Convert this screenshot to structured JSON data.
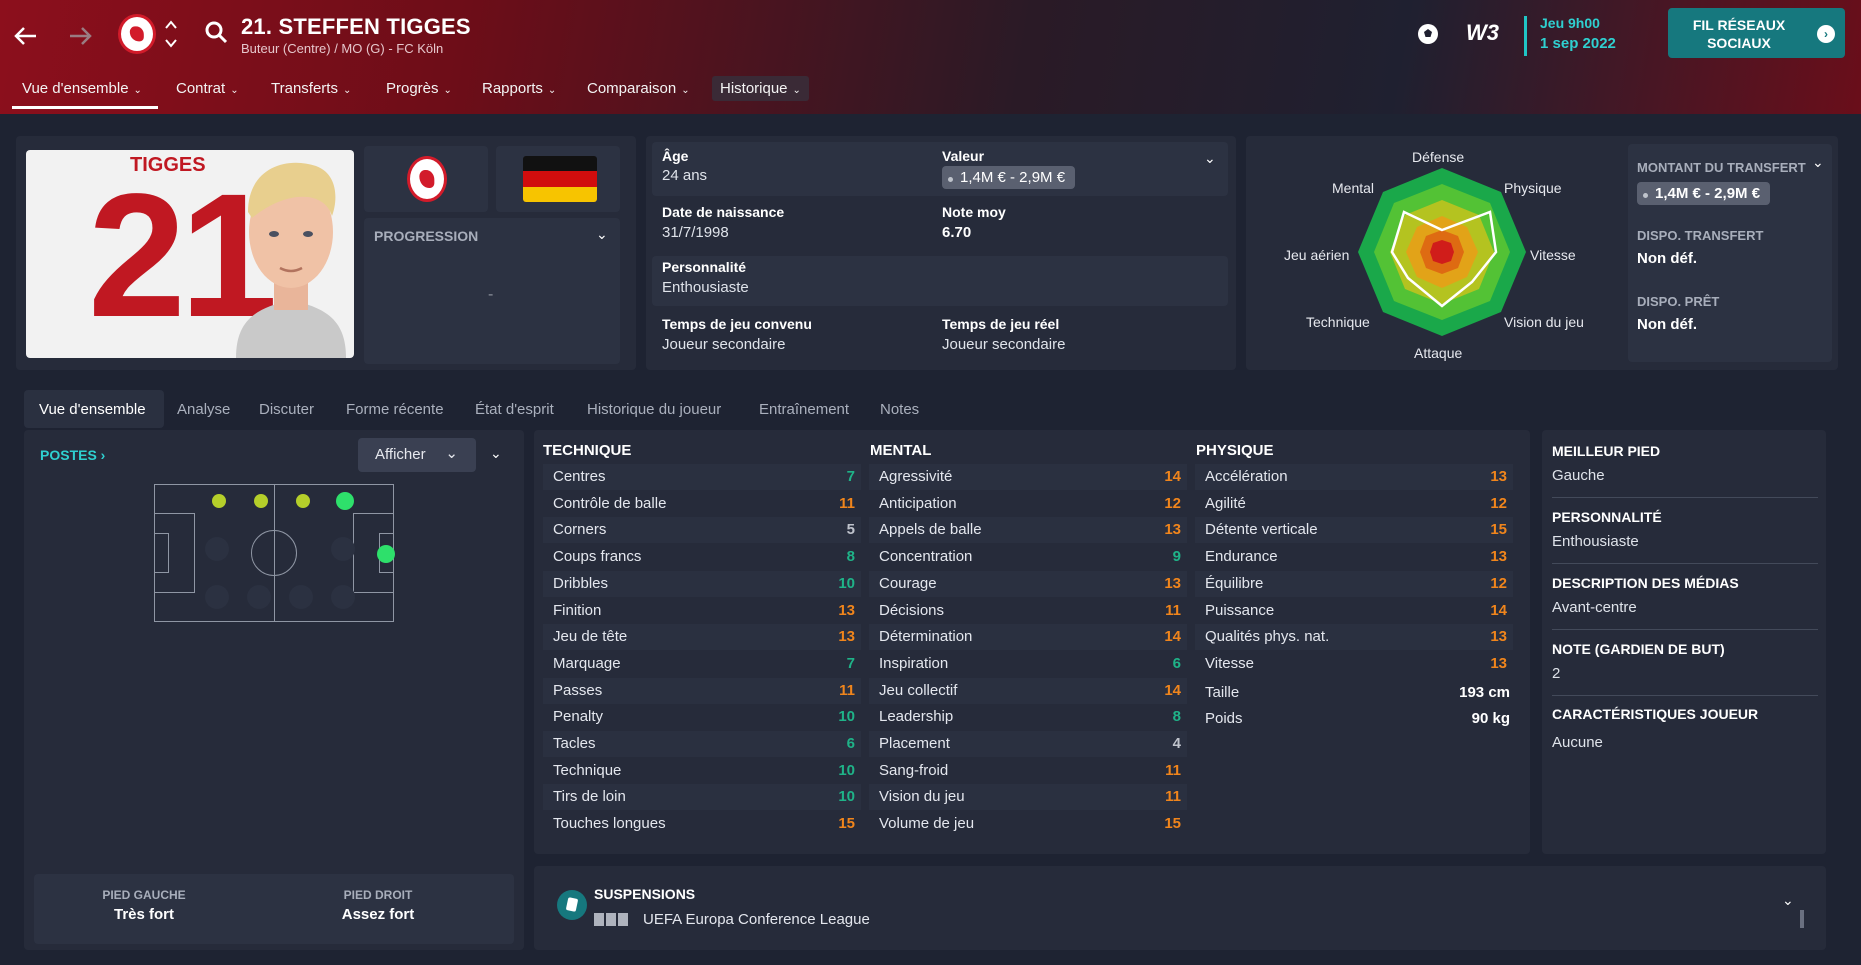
{
  "header": {
    "back_icon": "arrow-left-icon",
    "forward_icon": "arrow-right-icon",
    "player_name": "21. STEFFEN TIGGES",
    "player_subtitle": "Buteur (Centre) / MO (G) - FC Köln",
    "menu": [
      {
        "label": "Vue d'ensemble"
      },
      {
        "label": "Contrat"
      },
      {
        "label": "Transferts"
      },
      {
        "label": "Progrès"
      },
      {
        "label": "Rapports"
      },
      {
        "label": "Comparaison"
      },
      {
        "label": "Historique"
      }
    ],
    "date_line1": "Jeu 9h00",
    "date_line2": "1 sep 2022",
    "logo_text": "W3",
    "social_button": "FIL RÉSEAUX SOCIAUX"
  },
  "profile": {
    "shirt_name": "TIGGES",
    "shirt_number": "21",
    "progression_label": "PROGRESSION",
    "progression_value": "-",
    "age_label": "Âge",
    "age_value": "24 ans",
    "value_label": "Valeur",
    "value_value": "1,4M € - 2,9M €",
    "dob_label": "Date de naissance",
    "dob_value": "31/7/1998",
    "rating_label": "Note moy",
    "rating_value": "6.70",
    "personality_label": "Personnalité",
    "personality_value": "Enthousiaste",
    "agreed_time_label": "Temps de jeu convenu",
    "agreed_time_value": "Joueur secondaire",
    "real_time_label": "Temps de jeu réel",
    "real_time_value": "Joueur secondaire"
  },
  "radar": {
    "labels": {
      "defense": "Défense",
      "physique": "Physique",
      "vitesse": "Vitesse",
      "vision": "Vision du jeu",
      "attaque": "Attaque",
      "technique": "Technique",
      "aerien": "Jeu aérien",
      "mental": "Mental"
    }
  },
  "transfer": {
    "amount_label": "MONTANT DU TRANSFERT",
    "amount_value": "1,4M € - 2,9M €",
    "dispo_transfer_label": "DISPO. TRANSFERT",
    "dispo_transfer_value": "Non déf.",
    "dispo_loan_label": "DISPO. PRÊT",
    "dispo_loan_value": "Non déf."
  },
  "subtabs": [
    {
      "label": "Vue d'ensemble"
    },
    {
      "label": "Analyse"
    },
    {
      "label": "Discuter"
    },
    {
      "label": "Forme récente"
    },
    {
      "label": "État d'esprit"
    },
    {
      "label": "Historique du joueur"
    },
    {
      "label": "Entraînement"
    },
    {
      "label": "Notes"
    }
  ],
  "positions": {
    "title": "POSTES",
    "show_button": "Afficher"
  },
  "feet": {
    "left_label": "PIED GAUCHE",
    "left_value": "Très fort",
    "right_label": "PIED DROIT",
    "right_value": "Assez fort"
  },
  "attributes": {
    "technique": {
      "title": "TECHNIQUE",
      "rows": [
        {
          "name": "Centres",
          "value": "7",
          "tier": "green"
        },
        {
          "name": "Contrôle de balle",
          "value": "11",
          "tier": "orange"
        },
        {
          "name": "Corners",
          "value": "5",
          "tier": "grey"
        },
        {
          "name": "Coups francs",
          "value": "8",
          "tier": "green"
        },
        {
          "name": "Dribbles",
          "value": "10",
          "tier": "green"
        },
        {
          "name": "Finition",
          "value": "13",
          "tier": "orange"
        },
        {
          "name": "Jeu de tête",
          "value": "13",
          "tier": "orange"
        },
        {
          "name": "Marquage",
          "value": "7",
          "tier": "green"
        },
        {
          "name": "Passes",
          "value": "11",
          "tier": "orange"
        },
        {
          "name": "Penalty",
          "value": "10",
          "tier": "green"
        },
        {
          "name": "Tacles",
          "value": "6",
          "tier": "green"
        },
        {
          "name": "Technique",
          "value": "10",
          "tier": "green"
        },
        {
          "name": "Tirs de loin",
          "value": "10",
          "tier": "green"
        },
        {
          "name": "Touches longues",
          "value": "15",
          "tier": "orange"
        }
      ]
    },
    "mental": {
      "title": "MENTAL",
      "rows": [
        {
          "name": "Agressivité",
          "value": "14",
          "tier": "orange"
        },
        {
          "name": "Anticipation",
          "value": "12",
          "tier": "orange"
        },
        {
          "name": "Appels de balle",
          "value": "13",
          "tier": "orange"
        },
        {
          "name": "Concentration",
          "value": "9",
          "tier": "green"
        },
        {
          "name": "Courage",
          "value": "13",
          "tier": "orange"
        },
        {
          "name": "Décisions",
          "value": "11",
          "tier": "orange"
        },
        {
          "name": "Détermination",
          "value": "14",
          "tier": "orange"
        },
        {
          "name": "Inspiration",
          "value": "6",
          "tier": "green"
        },
        {
          "name": "Jeu collectif",
          "value": "14",
          "tier": "orange"
        },
        {
          "name": "Leadership",
          "value": "8",
          "tier": "green"
        },
        {
          "name": "Placement",
          "value": "4",
          "tier": "grey"
        },
        {
          "name": "Sang-froid",
          "value": "11",
          "tier": "orange"
        },
        {
          "name": "Vision du jeu",
          "value": "11",
          "tier": "orange"
        },
        {
          "name": "Volume de jeu",
          "value": "15",
          "tier": "orange"
        }
      ]
    },
    "physique": {
      "title": "PHYSIQUE",
      "rows": [
        {
          "name": "Accélération",
          "value": "13",
          "tier": "orange"
        },
        {
          "name": "Agilité",
          "value": "12",
          "tier": "orange"
        },
        {
          "name": "Détente verticale",
          "value": "15",
          "tier": "orange"
        },
        {
          "name": "Endurance",
          "value": "13",
          "tier": "orange"
        },
        {
          "name": "Équilibre",
          "value": "12",
          "tier": "orange"
        },
        {
          "name": "Puissance",
          "value": "14",
          "tier": "orange"
        },
        {
          "name": "Qualités phys. nat.",
          "value": "13",
          "tier": "orange"
        },
        {
          "name": "Vitesse",
          "value": "13",
          "tier": "orange"
        }
      ],
      "height_label": "Taille",
      "height_value": "193 cm",
      "weight_label": "Poids",
      "weight_value": "90 kg"
    }
  },
  "side": {
    "best_foot_label": "MEILLEUR PIED",
    "best_foot_value": "Gauche",
    "personality_label": "PERSONNALITÉ",
    "personality_value": "Enthousiaste",
    "media_label": "DESCRIPTION DES MÉDIAS",
    "media_value": "Avant-centre",
    "gk_label": "NOTE (GARDIEN DE BUT)",
    "gk_value": "2",
    "traits_label": "CARACTÉRISTIQUES JOUEUR",
    "traits_value": "Aucune"
  },
  "suspensions": {
    "title": "SUSPENSIONS",
    "competition": "UEFA Europa Conference League"
  },
  "colors": {
    "accent_red": "#d21b2a",
    "teal": "#16787e",
    "attr_high": "#f0851c",
    "attr_mid": "#1fb388"
  }
}
